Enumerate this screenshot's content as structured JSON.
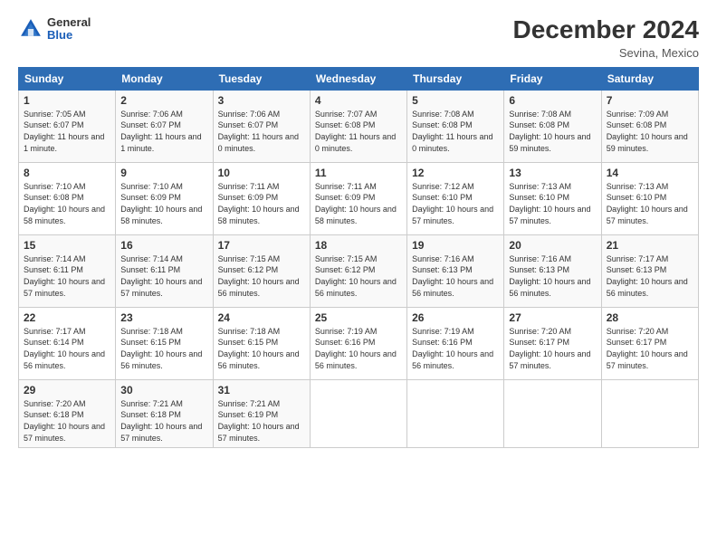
{
  "logo": {
    "general": "General",
    "blue": "Blue"
  },
  "title": "December 2024",
  "location": "Sevina, Mexico",
  "days_of_week": [
    "Sunday",
    "Monday",
    "Tuesday",
    "Wednesday",
    "Thursday",
    "Friday",
    "Saturday"
  ],
  "weeks": [
    [
      {
        "day": "1",
        "sunrise": "7:05 AM",
        "sunset": "6:07 PM",
        "daylight": "11 hours and 1 minute."
      },
      {
        "day": "2",
        "sunrise": "7:06 AM",
        "sunset": "6:07 PM",
        "daylight": "11 hours and 1 minute."
      },
      {
        "day": "3",
        "sunrise": "7:06 AM",
        "sunset": "6:07 PM",
        "daylight": "11 hours and 0 minutes."
      },
      {
        "day": "4",
        "sunrise": "7:07 AM",
        "sunset": "6:08 PM",
        "daylight": "11 hours and 0 minutes."
      },
      {
        "day": "5",
        "sunrise": "7:08 AM",
        "sunset": "6:08 PM",
        "daylight": "11 hours and 0 minutes."
      },
      {
        "day": "6",
        "sunrise": "7:08 AM",
        "sunset": "6:08 PM",
        "daylight": "10 hours and 59 minutes."
      },
      {
        "day": "7",
        "sunrise": "7:09 AM",
        "sunset": "6:08 PM",
        "daylight": "10 hours and 59 minutes."
      }
    ],
    [
      {
        "day": "8",
        "sunrise": "7:10 AM",
        "sunset": "6:08 PM",
        "daylight": "10 hours and 58 minutes."
      },
      {
        "day": "9",
        "sunrise": "7:10 AM",
        "sunset": "6:09 PM",
        "daylight": "10 hours and 58 minutes."
      },
      {
        "day": "10",
        "sunrise": "7:11 AM",
        "sunset": "6:09 PM",
        "daylight": "10 hours and 58 minutes."
      },
      {
        "day": "11",
        "sunrise": "7:11 AM",
        "sunset": "6:09 PM",
        "daylight": "10 hours and 58 minutes."
      },
      {
        "day": "12",
        "sunrise": "7:12 AM",
        "sunset": "6:10 PM",
        "daylight": "10 hours and 57 minutes."
      },
      {
        "day": "13",
        "sunrise": "7:13 AM",
        "sunset": "6:10 PM",
        "daylight": "10 hours and 57 minutes."
      },
      {
        "day": "14",
        "sunrise": "7:13 AM",
        "sunset": "6:10 PM",
        "daylight": "10 hours and 57 minutes."
      }
    ],
    [
      {
        "day": "15",
        "sunrise": "7:14 AM",
        "sunset": "6:11 PM",
        "daylight": "10 hours and 57 minutes."
      },
      {
        "day": "16",
        "sunrise": "7:14 AM",
        "sunset": "6:11 PM",
        "daylight": "10 hours and 57 minutes."
      },
      {
        "day": "17",
        "sunrise": "7:15 AM",
        "sunset": "6:12 PM",
        "daylight": "10 hours and 56 minutes."
      },
      {
        "day": "18",
        "sunrise": "7:15 AM",
        "sunset": "6:12 PM",
        "daylight": "10 hours and 56 minutes."
      },
      {
        "day": "19",
        "sunrise": "7:16 AM",
        "sunset": "6:13 PM",
        "daylight": "10 hours and 56 minutes."
      },
      {
        "day": "20",
        "sunrise": "7:16 AM",
        "sunset": "6:13 PM",
        "daylight": "10 hours and 56 minutes."
      },
      {
        "day": "21",
        "sunrise": "7:17 AM",
        "sunset": "6:13 PM",
        "daylight": "10 hours and 56 minutes."
      }
    ],
    [
      {
        "day": "22",
        "sunrise": "7:17 AM",
        "sunset": "6:14 PM",
        "daylight": "10 hours and 56 minutes."
      },
      {
        "day": "23",
        "sunrise": "7:18 AM",
        "sunset": "6:15 PM",
        "daylight": "10 hours and 56 minutes."
      },
      {
        "day": "24",
        "sunrise": "7:18 AM",
        "sunset": "6:15 PM",
        "daylight": "10 hours and 56 minutes."
      },
      {
        "day": "25",
        "sunrise": "7:19 AM",
        "sunset": "6:16 PM",
        "daylight": "10 hours and 56 minutes."
      },
      {
        "day": "26",
        "sunrise": "7:19 AM",
        "sunset": "6:16 PM",
        "daylight": "10 hours and 56 minutes."
      },
      {
        "day": "27",
        "sunrise": "7:20 AM",
        "sunset": "6:17 PM",
        "daylight": "10 hours and 57 minutes."
      },
      {
        "day": "28",
        "sunrise": "7:20 AM",
        "sunset": "6:17 PM",
        "daylight": "10 hours and 57 minutes."
      }
    ],
    [
      {
        "day": "29",
        "sunrise": "7:20 AM",
        "sunset": "6:18 PM",
        "daylight": "10 hours and 57 minutes."
      },
      {
        "day": "30",
        "sunrise": "7:21 AM",
        "sunset": "6:18 PM",
        "daylight": "10 hours and 57 minutes."
      },
      {
        "day": "31",
        "sunrise": "7:21 AM",
        "sunset": "6:19 PM",
        "daylight": "10 hours and 57 minutes."
      },
      null,
      null,
      null,
      null
    ]
  ],
  "labels": {
    "sunrise": "Sunrise:",
    "sunset": "Sunset:",
    "daylight": "Daylight:"
  }
}
